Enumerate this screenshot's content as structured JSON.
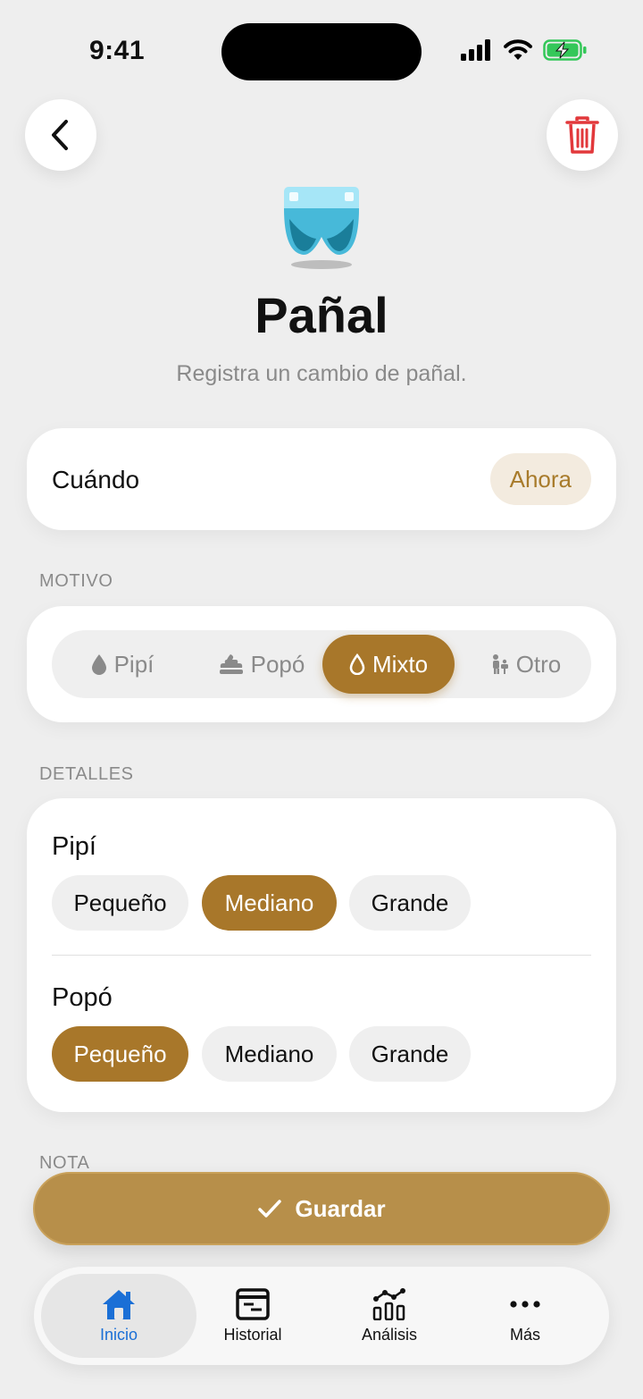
{
  "status_bar": {
    "time": "9:41"
  },
  "header": {
    "title": "Pañal",
    "subtitle": "Registra un cambio de pañal."
  },
  "when": {
    "label": "Cuándo",
    "value": "Ahora"
  },
  "motive": {
    "section_label": "MOTIVO",
    "options": [
      {
        "label": "Pipí",
        "icon": "drop-icon"
      },
      {
        "label": "Popó",
        "icon": "poop-icon"
      },
      {
        "label": "Mixto",
        "icon": "drop-icon"
      },
      {
        "label": "Otro",
        "icon": "baby-changing-icon"
      }
    ],
    "selected": "Mixto"
  },
  "details": {
    "section_label": "DETALLES",
    "groups": [
      {
        "title": "Pipí",
        "options": [
          "Pequeño",
          "Mediano",
          "Grande"
        ],
        "selected": "Mediano"
      },
      {
        "title": "Popó",
        "options": [
          "Pequeño",
          "Mediano",
          "Grande"
        ],
        "selected": "Pequeño"
      }
    ]
  },
  "note": {
    "section_label": "NOTA"
  },
  "save_button": {
    "label": "Guardar"
  },
  "tabbar": {
    "items": [
      {
        "label": "Inicio",
        "icon": "home-icon"
      },
      {
        "label": "Historial",
        "icon": "history-icon"
      },
      {
        "label": "Análisis",
        "icon": "analytics-icon"
      },
      {
        "label": "Más",
        "icon": "more-icon"
      }
    ],
    "active": "Inicio"
  },
  "colors": {
    "accent": "#a8772a",
    "accent_light": "#f3ebdf",
    "danger": "#e2383b",
    "tab_active": "#1a6fd6",
    "background": "#eeeeee"
  }
}
